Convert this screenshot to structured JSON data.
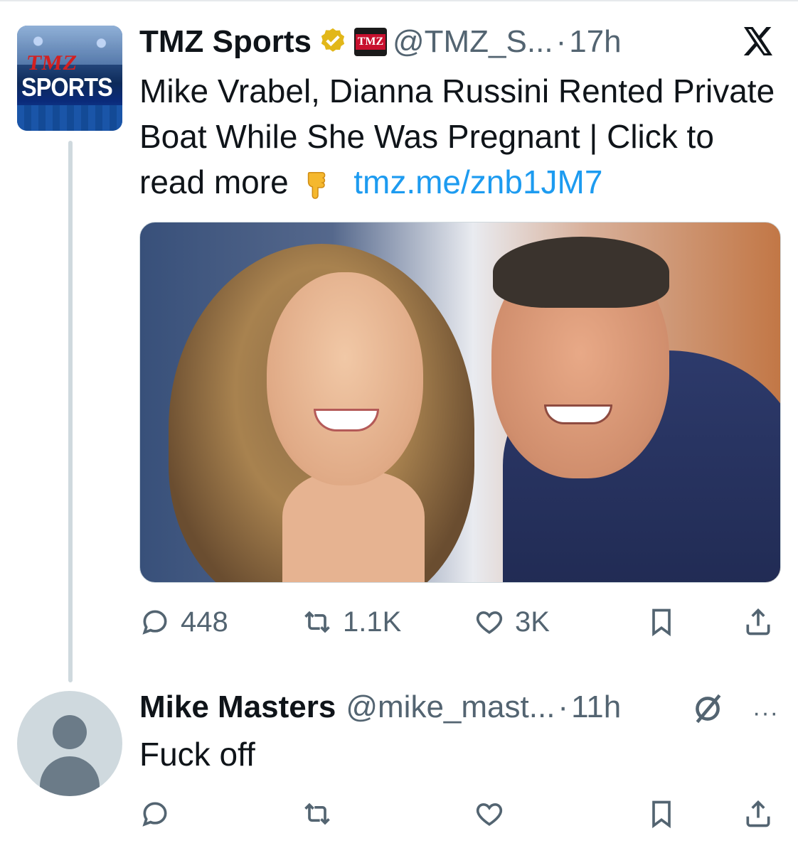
{
  "tweet": {
    "author_name": "TMZ Sports",
    "handle": "@TMZ_S...",
    "dot": "·",
    "time": "17h",
    "text_main": "Mike Vrabel, Dianna Russini Rented Private Boat While She Was Pregnant  |  Click to read more",
    "link_text": "tmz.me/znb1JM7",
    "avatar_text_top": "TMZ",
    "avatar_text_bottom": "SPORTS",
    "badge_text": "TMZ",
    "stats": {
      "replies": "448",
      "reposts": "1.1K",
      "likes": "3K"
    }
  },
  "reply": {
    "author_name": "Mike Masters",
    "handle": "@mike_mast...",
    "dot": "·",
    "time": "11h",
    "text": "Fuck off",
    "more": "···"
  },
  "icons": {
    "platform": "x-logo-icon",
    "verified": "verified-badge-icon",
    "pointing": "pointing-down-emoji",
    "reply": "reply-icon",
    "repost": "repost-icon",
    "like": "heart-icon",
    "bookmark": "bookmark-icon",
    "share": "share-icon",
    "muted": "muted-icon"
  },
  "colors": {
    "link": "#1d9bf0",
    "secondary_text": "#536471",
    "verified": "#e2b719"
  }
}
